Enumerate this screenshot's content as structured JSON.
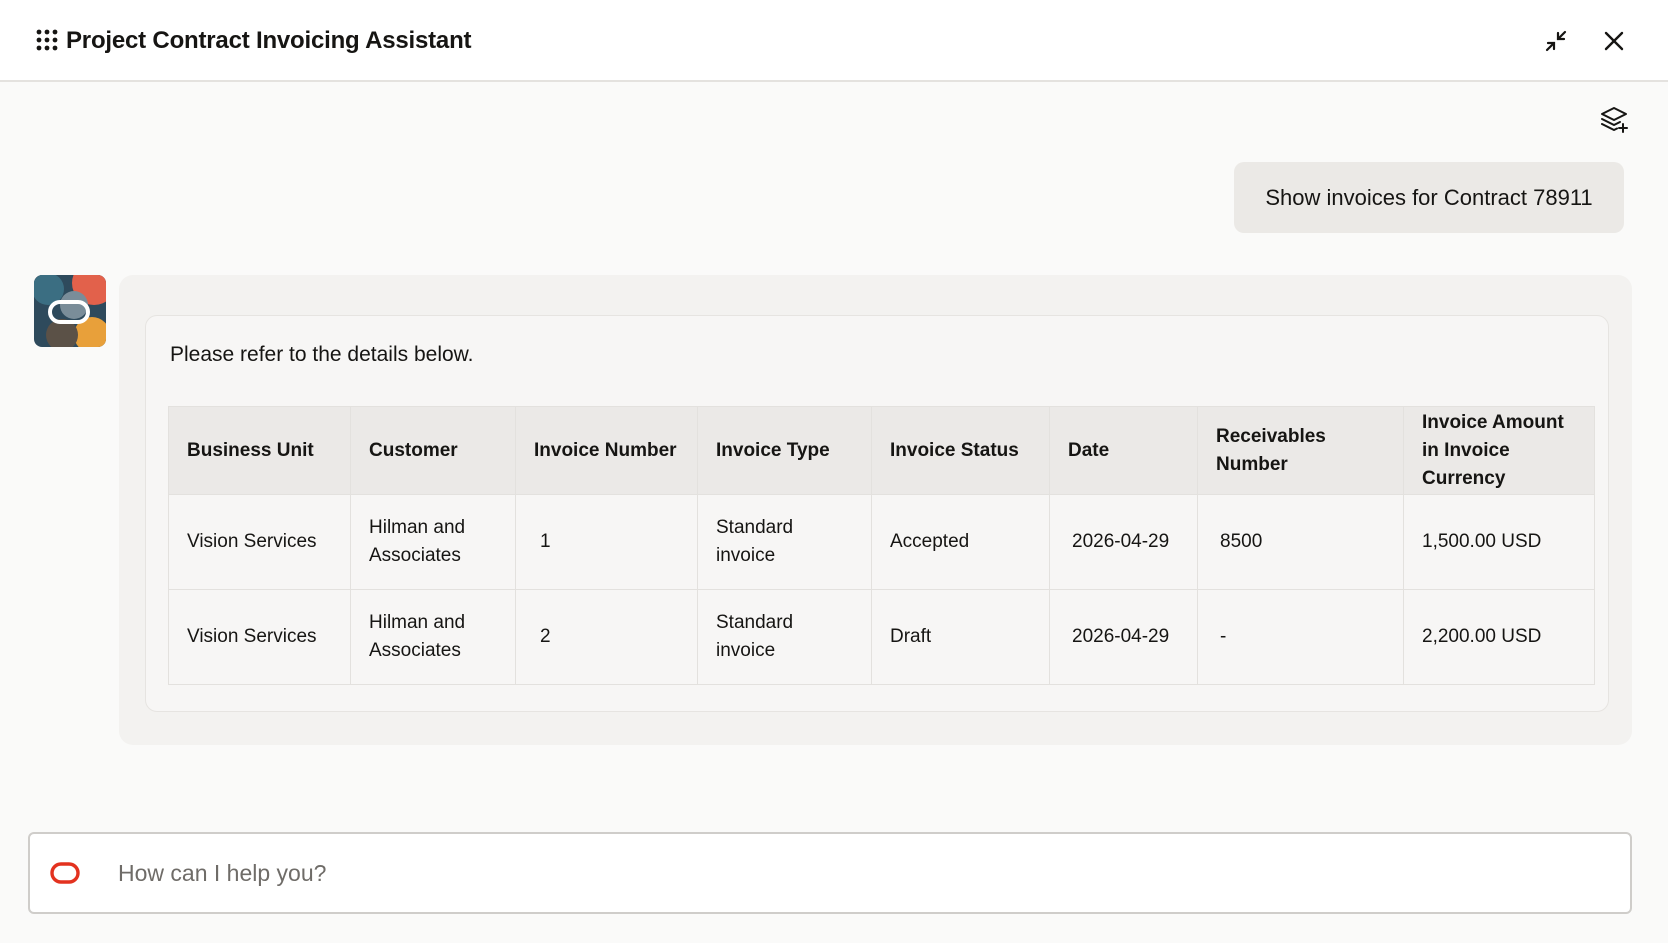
{
  "header": {
    "title": "Project Contract Invoicing Assistant",
    "icons": {
      "menu": "grid-dots-icon",
      "minimize": "collapse-arrows-icon",
      "close": "close-icon"
    }
  },
  "toolbar": {
    "layers_icon": "layers-plus-icon"
  },
  "conversation": {
    "user_message": "Show invoices for Contract 78911",
    "bot": {
      "intro": "Please refer to the details below.",
      "table": {
        "headers": [
          "Business Unit",
          "Customer",
          "Invoice Number",
          "Invoice Type",
          "Invoice Status",
          "Date",
          "Receivables Number",
          "Invoice Amount in Invoice Currency"
        ],
        "rows": [
          [
            "Vision Services",
            "Hilman and Associates",
            "1",
            "Standard invoice",
            "Accepted",
            "2026-04-29",
            "8500",
            "1,500.00 USD"
          ],
          [
            "Vision Services",
            "Hilman and Associates",
            "2",
            "Standard invoice",
            "Draft",
            "2026-04-29",
            "-",
            "2,200.00 USD"
          ]
        ]
      }
    }
  },
  "input": {
    "placeholder": "How can I help you?",
    "value": ""
  },
  "colors": {
    "oracle_red": "#e3321f",
    "header_bg": "#ffffff",
    "page_bg": "#fafaf9",
    "card_bg": "#f3f2f0"
  }
}
